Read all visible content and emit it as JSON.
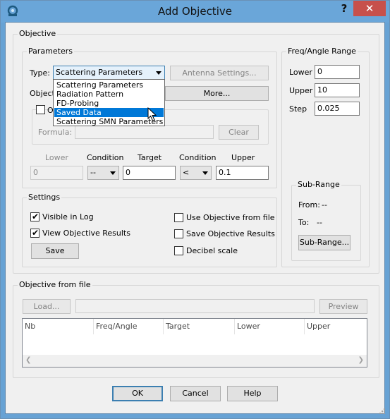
{
  "window": {
    "title": "Add Objective",
    "help": "?",
    "close": "✕"
  },
  "objective": {
    "group_label": "Objective",
    "parameters": {
      "group_label": "Parameters",
      "type_label": "Type:",
      "type_value": "Scattering Parameters",
      "type_options": [
        "Scattering Parameters",
        "Radiation Pattern",
        "FD-Probing",
        "Saved Data",
        "Scattering SMN Parameters"
      ],
      "type_selected_index": 3,
      "antenna_button": "Antenna Settings...",
      "objective_label": "Objecti",
      "more_button": "More...",
      "checkbox_label": "O",
      "formula_label": "Formula:",
      "clear_button": "Clear"
    },
    "criteria": {
      "headers": {
        "lower": "Lower",
        "condition1": "Condition",
        "target": "Target",
        "condition2": "Condition",
        "upper": "Upper"
      },
      "lower_value": "0",
      "condition1_value": "--",
      "target_value": "0",
      "condition2_value": "<",
      "upper_value": "0.1"
    },
    "settings": {
      "group_label": "Settings",
      "visible_in_log": "Visible in Log",
      "visible_in_log_checked": true,
      "view_results": "View Objective Results",
      "view_results_checked": true,
      "save_button": "Save",
      "use_from_file": "Use Objective from file",
      "save_results": "Save Objective Results",
      "decibel": "Decibel scale"
    },
    "freq_range": {
      "group_label": "Freq/Angle Range",
      "lower_label": "Lower",
      "lower_value": "0",
      "upper_label": "Upper",
      "upper_value": "10",
      "step_label": "Step",
      "step_value": "0.025",
      "sub_range": {
        "group_label": "Sub-Range",
        "from_label": "From:",
        "from_value": "--",
        "to_label": "To:",
        "to_value": "--",
        "button": "Sub-Range..."
      }
    }
  },
  "from_file": {
    "group_label": "Objective from file",
    "load_button": "Load...",
    "preview_button": "Preview",
    "columns": [
      "Nb",
      "Freq/Angle",
      "Target",
      "Lower",
      "Upper"
    ]
  },
  "footer": {
    "ok": "OK",
    "cancel": "Cancel",
    "help": "Help"
  }
}
